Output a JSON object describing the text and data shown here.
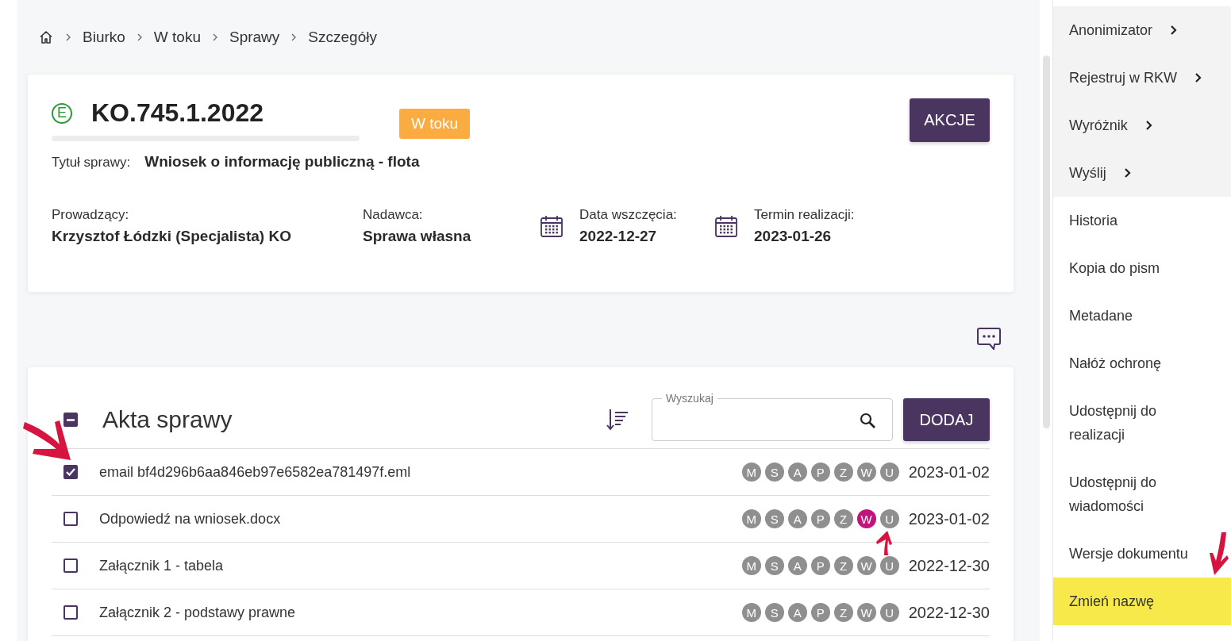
{
  "breadcrumb": [
    "Biurko",
    "W toku",
    "Sprawy",
    "Szczegóły"
  ],
  "case": {
    "badge": "E",
    "number": "KO.745.1.2022",
    "status": "W toku",
    "actions_button": "AKCJE",
    "title_label": "Tytuł sprawy:",
    "title": "Wniosek o informację publiczną - flota",
    "fields": [
      {
        "kind": "text",
        "label": "Prowadzący:",
        "value": "Krzysztof Łódzki (Specjalista) KO"
      },
      {
        "kind": "text",
        "label": "Nadawca:",
        "value": "Sprawa własna"
      },
      {
        "kind": "date",
        "label": "Data wszczęcia:",
        "value": "2022-12-27"
      },
      {
        "kind": "date",
        "label": "Termin realizacji:",
        "value": "2023-01-26"
      }
    ]
  },
  "files": {
    "title": "Akta sprawy",
    "select_all_indeterminate": true,
    "search": {
      "label": "Wyszukaj"
    },
    "add_button": "DODAJ",
    "rows": [
      {
        "name": "email bf4d296b6aa846eb97e6582ea781497f.eml",
        "checked": true,
        "date": "2023-01-02",
        "markers": [
          {
            "letter": "M",
            "on": false
          },
          {
            "letter": "S",
            "on": false
          },
          {
            "letter": "A",
            "on": false
          },
          {
            "letter": "P",
            "on": false
          },
          {
            "letter": "Z",
            "on": false
          },
          {
            "letter": "W",
            "on": false
          },
          {
            "letter": "U",
            "on": false
          }
        ]
      },
      {
        "name": "Odpowiedź na wniosek.docx",
        "checked": false,
        "date": "2023-01-02",
        "markers": [
          {
            "letter": "M",
            "on": false
          },
          {
            "letter": "S",
            "on": false
          },
          {
            "letter": "A",
            "on": false
          },
          {
            "letter": "P",
            "on": false
          },
          {
            "letter": "Z",
            "on": false
          },
          {
            "letter": "W",
            "on": true
          },
          {
            "letter": "U",
            "on": false
          }
        ]
      },
      {
        "name": "Załącznik 1 - tabela",
        "checked": false,
        "date": "2022-12-30",
        "markers": [
          {
            "letter": "M",
            "on": false
          },
          {
            "letter": "S",
            "on": false
          },
          {
            "letter": "A",
            "on": false
          },
          {
            "letter": "P",
            "on": false
          },
          {
            "letter": "Z",
            "on": false
          },
          {
            "letter": "W",
            "on": false
          },
          {
            "letter": "U",
            "on": false
          }
        ]
      },
      {
        "name": "Załącznik 2 - podstawy prawne",
        "checked": false,
        "date": "2022-12-30",
        "markers": [
          {
            "letter": "M",
            "on": false
          },
          {
            "letter": "S",
            "on": false
          },
          {
            "letter": "A",
            "on": false
          },
          {
            "letter": "P",
            "on": false
          },
          {
            "letter": "Z",
            "on": false
          },
          {
            "letter": "W",
            "on": false
          },
          {
            "letter": "U",
            "on": false
          }
        ]
      }
    ]
  },
  "sidebar": {
    "items": [
      {
        "label": "Anonimizator",
        "has_submenu": true,
        "highlighted": false
      },
      {
        "label": "Rejestruj w RKW",
        "has_submenu": true,
        "highlighted": false
      },
      {
        "label": "Wyróżnik",
        "has_submenu": true,
        "highlighted": false
      },
      {
        "label": "Wyślij",
        "has_submenu": true,
        "highlighted": false
      },
      {
        "label": "Historia",
        "has_submenu": false,
        "highlighted": false
      },
      {
        "label": "Kopia do pism",
        "has_submenu": false,
        "highlighted": false
      },
      {
        "label": "Metadane",
        "has_submenu": false,
        "highlighted": false
      },
      {
        "label": "Nałóż ochronę",
        "has_submenu": false,
        "highlighted": false
      },
      {
        "label": "Udostępnij do realizacji",
        "has_submenu": false,
        "highlighted": false
      },
      {
        "label": "Udostępnij do wiadomości",
        "has_submenu": false,
        "highlighted": false
      },
      {
        "label": "Wersje dokumentu",
        "has_submenu": false,
        "highlighted": false
      },
      {
        "label": "Zmień nazwę",
        "has_submenu": false,
        "highlighted": true
      }
    ]
  }
}
